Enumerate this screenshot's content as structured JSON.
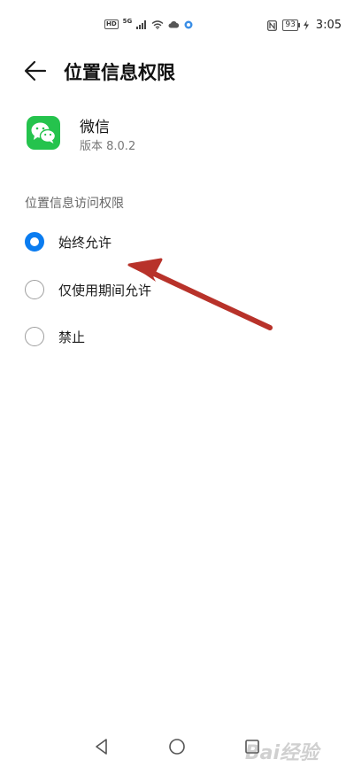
{
  "status_bar": {
    "hd": "HD",
    "network": "5G",
    "battery": "93",
    "time": "3:05"
  },
  "header": {
    "title": "位置信息权限",
    "back_icon": "arrow-left-icon"
  },
  "app": {
    "name": "微信",
    "version": "版本 8.0.2",
    "icon": "wechat-icon",
    "brand_color": "#25c34d"
  },
  "location_access": {
    "label": "位置信息访问权限",
    "options": [
      {
        "label": "始终允许",
        "selected": true
      },
      {
        "label": "仅使用期间允许",
        "selected": false
      },
      {
        "label": "禁止",
        "selected": false
      }
    ],
    "accent_color": "#0a7cf0"
  },
  "annotation": {
    "color": "#c0392b"
  },
  "nav_bar": {
    "back": "triangle-back-icon",
    "home": "circle-home-icon",
    "recents": "square-recents-icon"
  },
  "watermark": "Bai经验"
}
